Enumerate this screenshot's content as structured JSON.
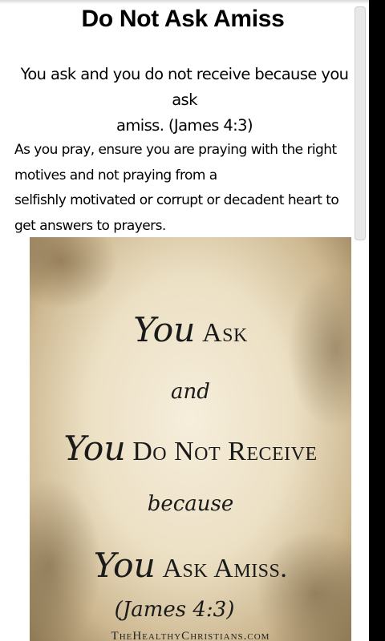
{
  "article": {
    "title": "Do Not Ask Amiss",
    "verse_line1": "You ask and you do not receive because you ask",
    "verse_line2": "amiss. (James 4:3)",
    "body_lines": [
      "As you pray, ensure you are praying with the right",
      "motives and not praying from a",
      "selfishly motivated or corrupt or decadent heart to",
      "get answers to prayers."
    ]
  },
  "image": {
    "line1_script": "You",
    "line1_caps": "Ask",
    "line2": "and",
    "line3_script": "You",
    "line3_caps": "Do Not Receive",
    "line4": "because",
    "line5_script": "You",
    "line5_caps": "Ask Amiss.",
    "line6": "(James 4:3)",
    "watermark": "TheHealthyChristians.com"
  },
  "colors": {
    "background": "#ffffff",
    "frame": "#000000",
    "parchment": "#ece0c4"
  }
}
